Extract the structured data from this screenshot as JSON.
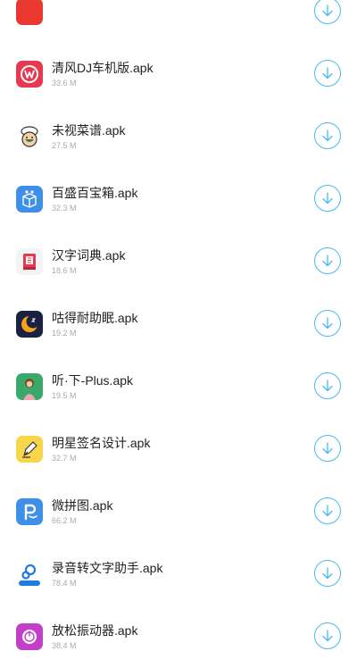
{
  "colors": {
    "accent": "#49b9ef",
    "text": "#222222",
    "subtext": "#aaaaaa"
  },
  "apps": [
    {
      "name": "",
      "size": "",
      "icon": "app-icon-red-partial"
    },
    {
      "name": "清风DJ车机版.apk",
      "size": "33.6 M",
      "icon": "qingfeng-dj-icon"
    },
    {
      "name": "未视菜谱.apk",
      "size": "27.5 M",
      "icon": "chef-icon"
    },
    {
      "name": "百盛百宝箱.apk",
      "size": "32.3 M",
      "icon": "toolbox-icon"
    },
    {
      "name": "汉字词典.apk",
      "size": "18.6 M",
      "icon": "dictionary-icon"
    },
    {
      "name": "咕得耐助眠.apk",
      "size": "19.2 M",
      "icon": "moon-sleep-icon"
    },
    {
      "name": "听·下-Plus.apk",
      "size": "19.5 M",
      "icon": "music-girl-icon"
    },
    {
      "name": "明星签名设计.apk",
      "size": "32.7 M",
      "icon": "pen-signature-icon"
    },
    {
      "name": "微拼图.apk",
      "size": "66.2 M",
      "icon": "puzzle-p-icon"
    },
    {
      "name": "录音转文字助手.apk",
      "size": "78.4 M",
      "icon": "voice-to-text-icon"
    },
    {
      "name": "放松振动器.apk",
      "size": "38.4 M",
      "icon": "vibrator-power-icon"
    }
  ]
}
